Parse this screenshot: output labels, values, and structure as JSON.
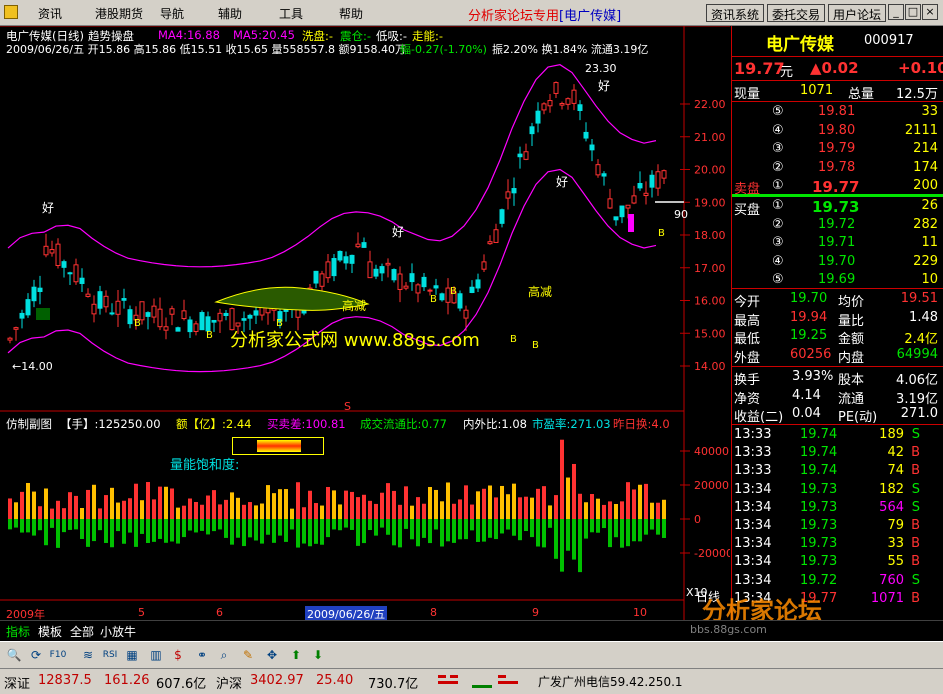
{
  "menubar": {
    "items": [
      "资讯",
      "港股期货",
      "导航",
      "辅助",
      "工具",
      "帮助"
    ],
    "title": "分析家论坛专用",
    "title_stock": "[电广传媒]",
    "buttons": [
      "资讯系统",
      "委托交易",
      "用户论坛"
    ],
    "window_controls": [
      "_",
      "□",
      "×"
    ]
  },
  "chart": {
    "title": "电广传媒(日线)",
    "indicator": "趋势操盘",
    "ma4": "MA4:16.88",
    "ma5": "MA5:20.45",
    "xipan": "洗盘:-",
    "zhencang": "震仓:-",
    "dixi": "低吸:-",
    "zoneng": "走能:-",
    "info_line": "2009/06/26/五 开15.86 高15.86 低15.51 收15.65 量558557.8 额9158.40万",
    "info_change": "幅-0.27(-1.70%)",
    "info_tail": "振2.20% 换1.84% 流通3.19亿",
    "watermark": "分析家公式网 www.88gs.com",
    "high_label": "23.30",
    "low_label": "←14.00",
    "right_edge_label": "90",
    "y_ticks": [
      "22.00",
      "21.00",
      "20.00",
      "19.00",
      "18.00",
      "17.00",
      "16.00",
      "15.00",
      "14.00"
    ],
    "annotations": {
      "hao": "好",
      "gaojian": "高减",
      "b": "B"
    },
    "marker_s": "S"
  },
  "sub": {
    "title": "仿制副图",
    "shou": "【手】:125250.00",
    "e": "额【亿】:2.44",
    "mai": "买卖差:100.81",
    "chengjiao": "成交流通比:0.77",
    "neiwai": "内外比:1.08",
    "shiying": "市盈率:271.03",
    "zuori": "昨日换:4.0",
    "liang_label": "量能饱和度:",
    "y_ticks": [
      "40000",
      "20000",
      "0",
      "-20000"
    ],
    "x10": "X10"
  },
  "time_axis": {
    "labels": [
      "2009年",
      "5",
      "6",
      "2009/06/26/五",
      "8",
      "9",
      "10"
    ]
  },
  "quote": {
    "name": "电广传媒",
    "code": "000917",
    "price": "19.77",
    "unit": "元",
    "change": "▲0.02",
    "change2": "+0.10",
    "xianliang_label": "现量",
    "xianliang": "1071",
    "zongliang_label": "总量",
    "zongliang": "12.5万",
    "sell": [
      {
        "n": "⑤",
        "p": "19.81",
        "v": "33"
      },
      {
        "n": "④",
        "p": "19.80",
        "v": "2111"
      },
      {
        "n": "③",
        "p": "19.79",
        "v": "214"
      },
      {
        "n": "②",
        "p": "19.78",
        "v": "174"
      },
      {
        "n": "①",
        "p": "19.77",
        "v": "200"
      }
    ],
    "sell_label": "卖盘",
    "buy_label": "买盘",
    "buy": [
      {
        "n": "①",
        "p": "19.73",
        "v": "26"
      },
      {
        "n": "②",
        "p": "19.72",
        "v": "282"
      },
      {
        "n": "③",
        "p": "19.71",
        "v": "11"
      },
      {
        "n": "④",
        "p": "19.70",
        "v": "229"
      },
      {
        "n": "⑤",
        "p": "19.69",
        "v": "10"
      }
    ],
    "stats": [
      {
        "l": "今开",
        "v": "19.70",
        "l2": "均价",
        "v2": "19.51"
      },
      {
        "l": "最高",
        "v": "19.94",
        "l2": "量比",
        "v2": "1.48"
      },
      {
        "l": "最低",
        "v": "19.25",
        "l2": "金额",
        "v2": "2.4亿"
      },
      {
        "l": "外盘",
        "v": "60256",
        "l2": "内盘",
        "v2": "64994"
      }
    ],
    "stats2": [
      {
        "l": "换手",
        "v": "3.93%",
        "l2": "股本",
        "v2": "4.06亿"
      },
      {
        "l": "净资",
        "v": "4.14",
        "l2": "流通",
        "v2": "3.19亿"
      },
      {
        "l": "收益(二)",
        "v": "0.04",
        "l2": "PE(动)",
        "v2": "271.0"
      }
    ],
    "ticks": [
      {
        "t": "13:33",
        "p": "19.74",
        "v": "189",
        "d": "S"
      },
      {
        "t": "13:33",
        "p": "19.74",
        "v": "42",
        "d": "B"
      },
      {
        "t": "13:33",
        "p": "19.74",
        "v": "74",
        "d": "B"
      },
      {
        "t": "13:34",
        "p": "19.73",
        "v": "182",
        "d": "S"
      },
      {
        "t": "13:34",
        "p": "19.73",
        "v": "564",
        "d": "S"
      },
      {
        "t": "13:34",
        "p": "19.73",
        "v": "79",
        "d": "B"
      },
      {
        "t": "13:34",
        "p": "19.73",
        "v": "33",
        "d": "B"
      },
      {
        "t": "13:34",
        "p": "19.73",
        "v": "55",
        "d": "B"
      },
      {
        "t": "13:34",
        "p": "19.72",
        "v": "760",
        "d": "S"
      },
      {
        "t": "13:34",
        "p": "19.77",
        "v": "1071",
        "d": "B"
      }
    ],
    "watermark": "分析家论坛",
    "watermark_url": "bbs.88gs.com",
    "bottom_tabs": [
      "笔",
      "价",
      "细",
      "盘",
      "势",
      "指",
      "值",
      "筹"
    ],
    "rili": "日线"
  },
  "tabs": [
    "指标",
    "模板",
    "全部",
    "小放牛"
  ],
  "status": {
    "sz_label": "深证",
    "sz_idx": "12837.5",
    "sz_chg": "161.26",
    "sz_amt": "607.6亿",
    "hs_label": "沪深",
    "hs_idx": "3402.97",
    "hs_chg": "25.40",
    "hs_amt": "730.7亿",
    "broker": "广发广州电信59.42.250.1"
  },
  "colors": {
    "up": "#ff3232",
    "down": "#00e0e0",
    "ma": "#ff00ff",
    "green": "#00e600",
    "yellow": "#ffff00"
  }
}
